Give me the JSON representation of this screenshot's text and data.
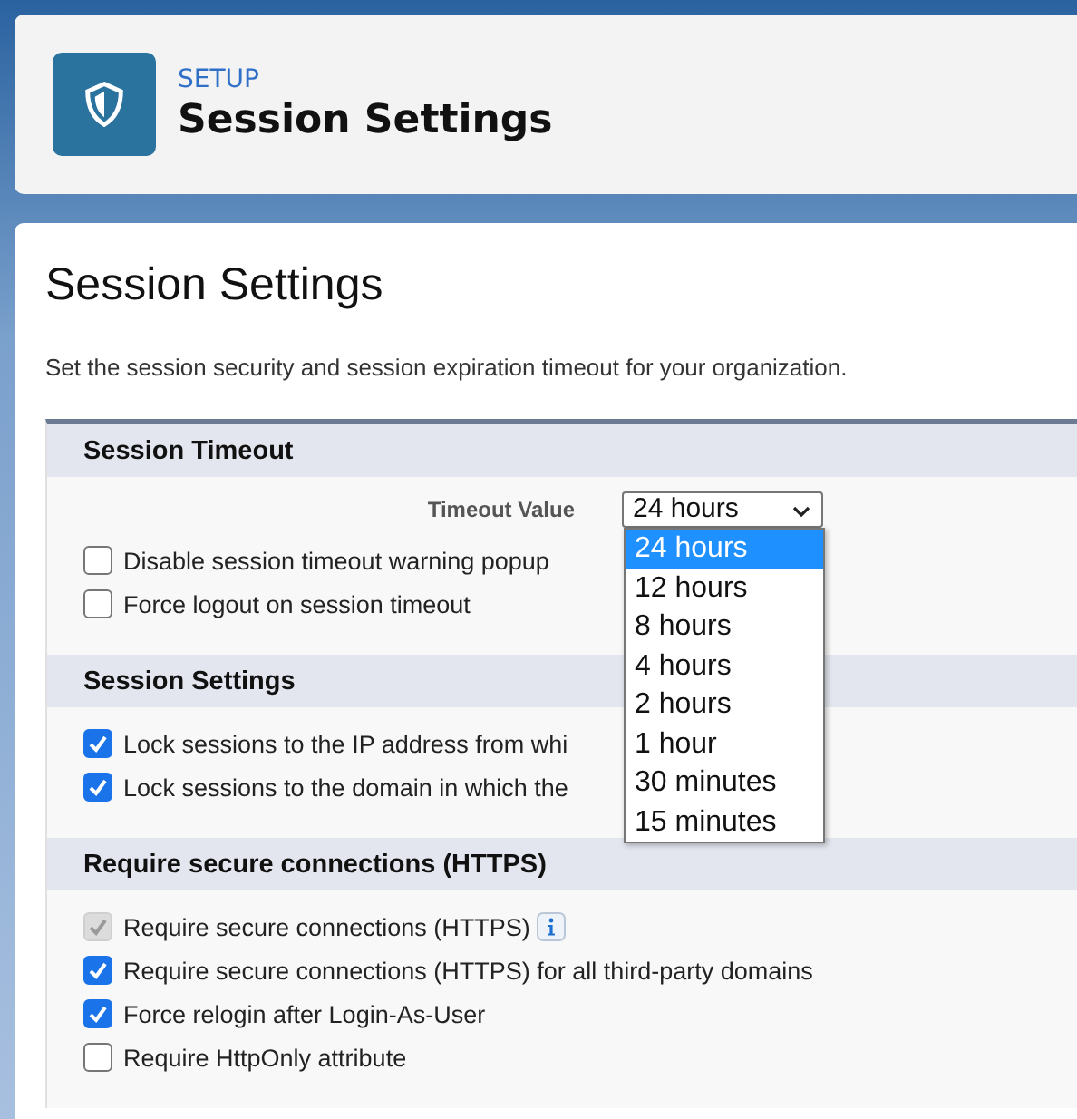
{
  "header": {
    "category": "SETUP",
    "title": "Session Settings"
  },
  "page": {
    "title": "Session Settings",
    "description": "Set the session security and session expiration timeout for your organization."
  },
  "sections": [
    {
      "title": "Session Timeout",
      "field": {
        "label": "Timeout Value",
        "value": "24 hours",
        "expanded": true,
        "options": [
          {
            "label": "24 hours",
            "selected": true
          },
          {
            "label": "12 hours",
            "selected": false
          },
          {
            "label": "8 hours",
            "selected": false
          },
          {
            "label": "4 hours",
            "selected": false
          },
          {
            "label": "2 hours",
            "selected": false
          },
          {
            "label": "1 hour",
            "selected": false
          },
          {
            "label": "30 minutes",
            "selected": false
          },
          {
            "label": "15 minutes",
            "selected": false
          }
        ]
      },
      "items": [
        {
          "label": "Disable session timeout warning popup",
          "checked": false,
          "disabled": false,
          "info": false
        },
        {
          "label": "Force logout on session timeout",
          "checked": false,
          "disabled": false,
          "info": false
        }
      ]
    },
    {
      "title": "Session Settings",
      "items": [
        {
          "label": "Lock sessions to the IP address from whi",
          "checked": true,
          "disabled": false,
          "info": false
        },
        {
          "label": "Lock sessions to the domain in which the",
          "checked": true,
          "disabled": false,
          "info": false
        }
      ]
    },
    {
      "title": "Require secure connections (HTTPS)",
      "items": [
        {
          "label": "Require secure connections (HTTPS)",
          "checked": true,
          "disabled": true,
          "info": true
        },
        {
          "label": "Require secure connections (HTTPS) for all third-party domains",
          "checked": true,
          "disabled": false,
          "info": false
        },
        {
          "label": "Force relogin after Login-As-User",
          "checked": true,
          "disabled": false,
          "info": false
        },
        {
          "label": "Require HttpOnly attribute",
          "checked": false,
          "disabled": false,
          "info": false
        }
      ]
    }
  ]
}
